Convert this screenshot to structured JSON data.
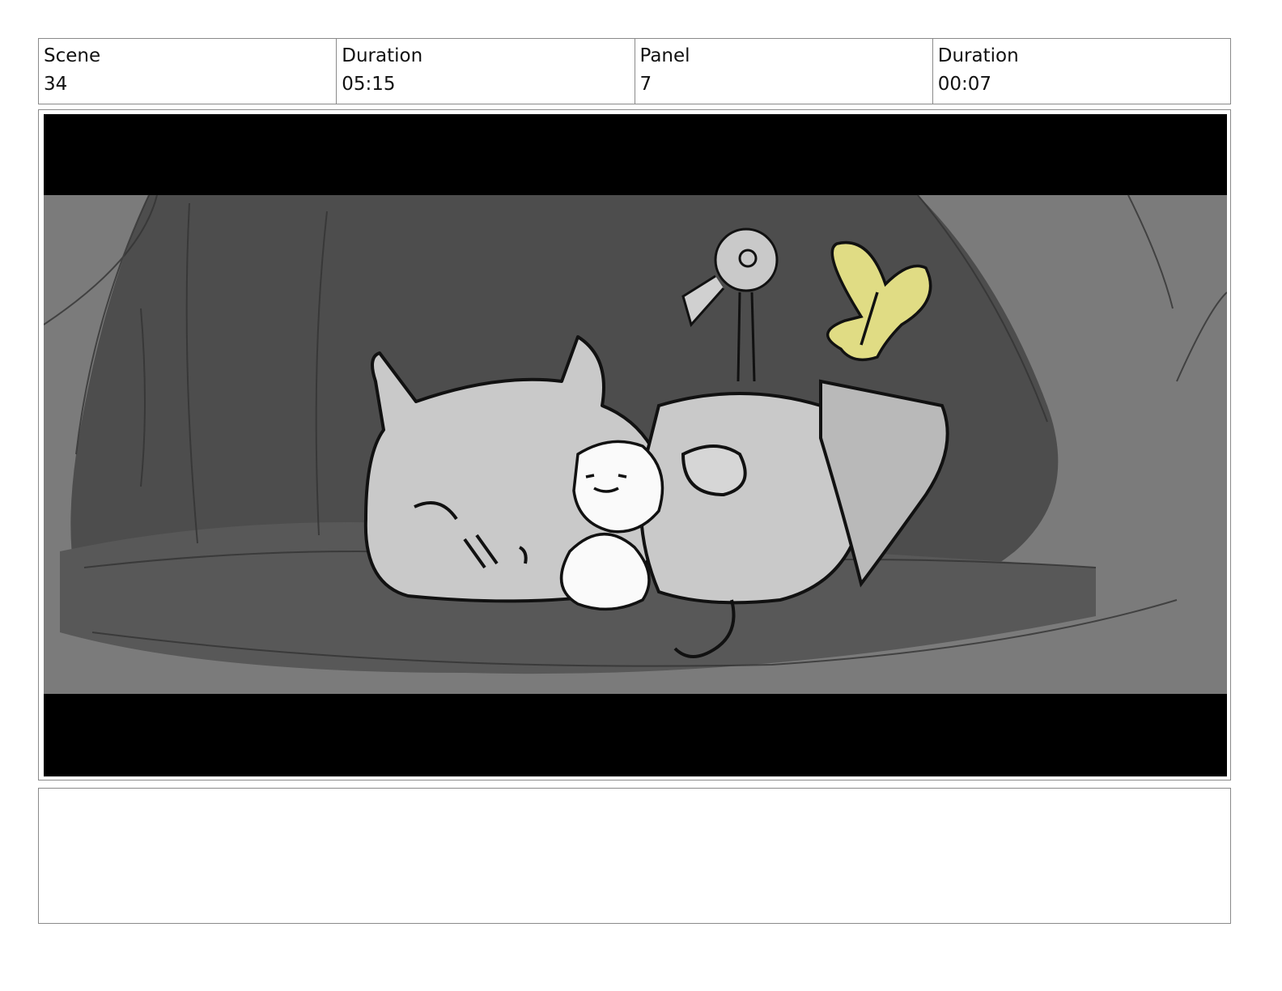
{
  "header": {
    "scene_label": "Scene",
    "scene_value": "34",
    "scene_duration_label": "Duration",
    "scene_duration_value": "05:15",
    "panel_label": "Panel",
    "panel_value": "7",
    "panel_duration_label": "Duration",
    "panel_duration_value": "00:07"
  },
  "panel": {
    "letterbox_color": "#000000",
    "accent_color": "#e0dc84"
  },
  "notes": {
    "text": ""
  }
}
